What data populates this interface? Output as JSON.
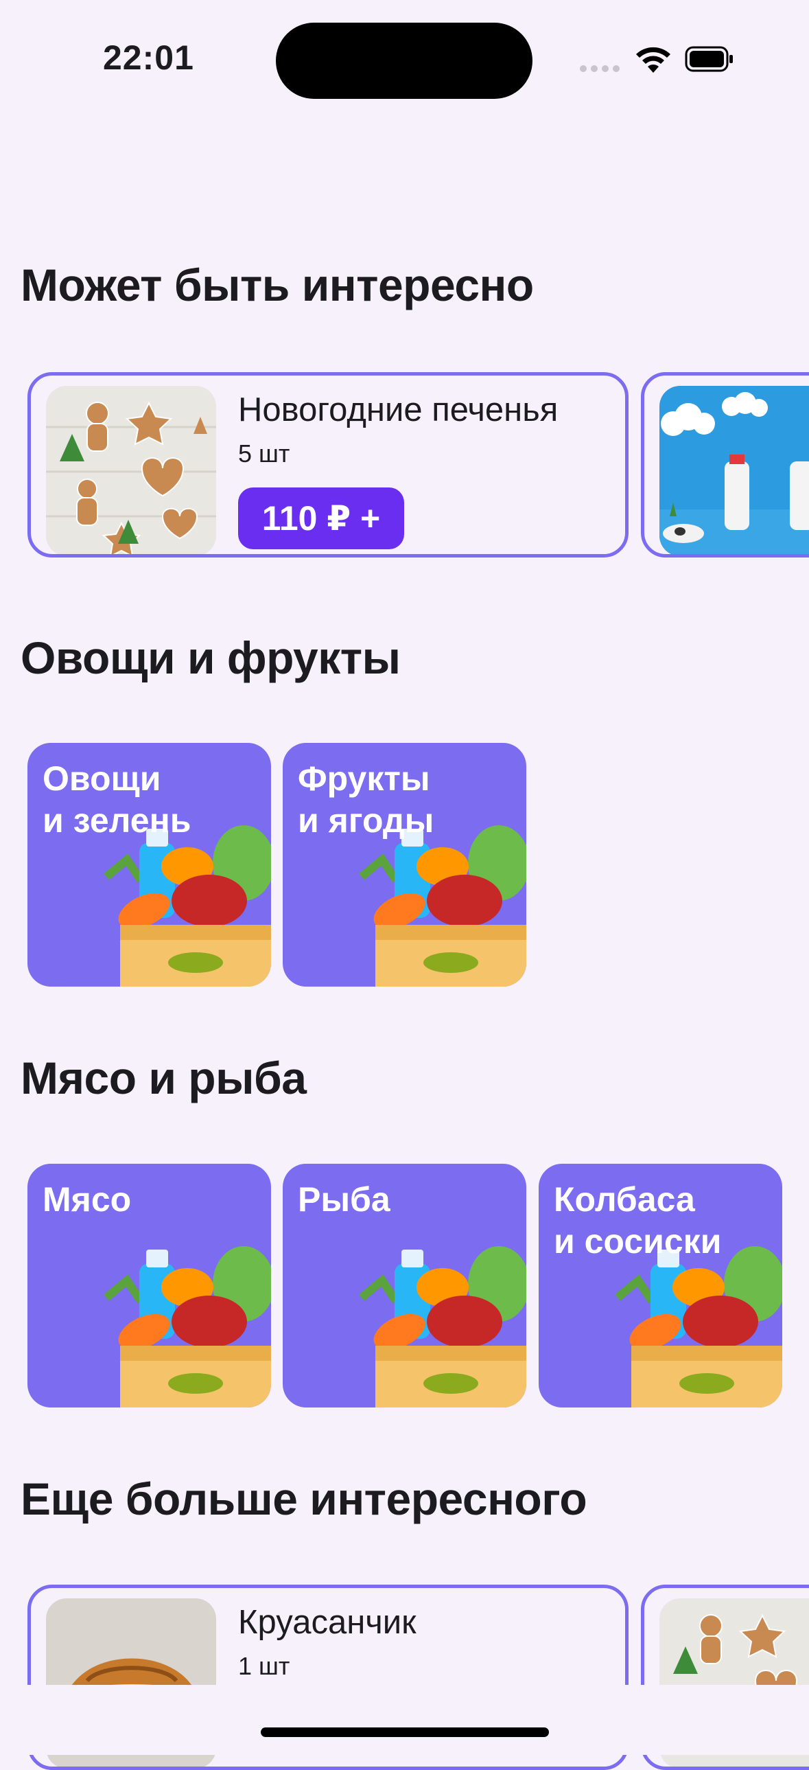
{
  "status": {
    "time": "22:01"
  },
  "sections": {
    "interesting": {
      "title": "Может быть интересно",
      "product": {
        "name": "Новогодние печенья",
        "qty": "5 шт",
        "price": "110 ₽ +"
      }
    },
    "veg_fruits": {
      "title": "Овощи и фрукты",
      "tiles": [
        "Овощи\nи зелень",
        "Фрукты\nи ягоды"
      ]
    },
    "meat_fish": {
      "title": "Мясо и рыба",
      "tiles": [
        "Мясо",
        "Рыба",
        "Колбаса\nи сосиски"
      ]
    },
    "more": {
      "title": "Еще больше интересного",
      "product": {
        "name": "Круасанчик",
        "qty": "1 шт"
      }
    }
  },
  "colors": {
    "accent": "#7B6CF0",
    "price_button": "#6A2EF0",
    "background": "#F6F1FA"
  }
}
